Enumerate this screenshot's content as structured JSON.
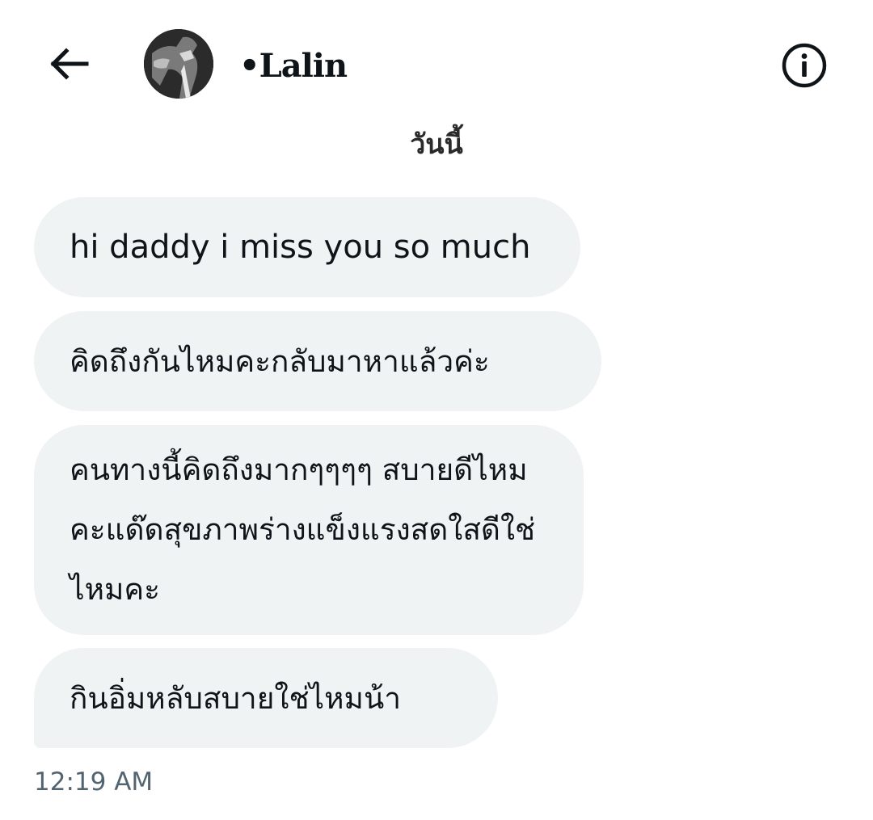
{
  "header": {
    "contact_name": "•Lalin"
  },
  "date_divider": "วันนี้",
  "messages": [
    {
      "text": "hi daddy i miss you so much"
    },
    {
      "text": "คิดถึงกันไหมคะกลับมาหาแล้วค่ะ"
    },
    {
      "text": "คนทางนี้คิดถึงมากๆๆๆๆ สบายดีไหมคะแด๊ดสุขภาพร่างแข็งแรงสดใสดีใช่ไหมคะ"
    },
    {
      "text": "กินอิ่มหลับสบายใช่ไหมน้า"
    }
  ],
  "timestamp": "12:19 AM",
  "colors": {
    "bubble_bg": "#eff3f4",
    "text": "#0f1419",
    "muted": "#536471"
  },
  "icons": {
    "back": "arrow-left-icon",
    "info": "info-circle-icon"
  }
}
